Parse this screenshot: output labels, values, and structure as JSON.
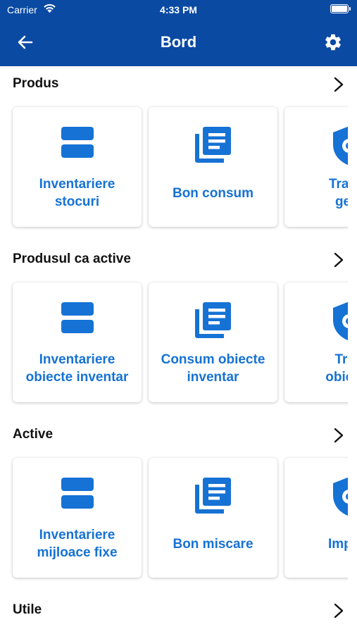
{
  "status_bar": {
    "carrier": "Carrier",
    "time": "4:33 PM"
  },
  "header": {
    "title": "Bord",
    "back_icon": "arrow-left-icon",
    "settings_icon": "gear-icon",
    "background": "#0a4aa3"
  },
  "accent_color": "#1672d4",
  "sections": [
    {
      "title": "Produs",
      "cards": [
        {
          "label": "Inventariere\nstocuri",
          "icon": "storage-icon"
        },
        {
          "label": "Bon consum",
          "icon": "document-stack-icon"
        },
        {
          "label": "Transf\ngest",
          "icon": "shield-icon"
        }
      ]
    },
    {
      "title": "Produsul ca active",
      "cards": [
        {
          "label": "Inventariere\nobiecte inventar",
          "icon": "storage-icon"
        },
        {
          "label": "Consum obiecte\ninventar",
          "icon": "document-stack-icon"
        },
        {
          "label": "Tran\nobiecte",
          "icon": "shield-icon"
        }
      ]
    },
    {
      "title": "Active",
      "cards": [
        {
          "label": "Inventariere\nmijloace fixe",
          "icon": "storage-icon"
        },
        {
          "label": "Bon miscare",
          "icon": "document-stack-icon"
        },
        {
          "label": "Import",
          "icon": "shield-icon"
        }
      ]
    },
    {
      "title": "Utile",
      "cards": []
    }
  ]
}
